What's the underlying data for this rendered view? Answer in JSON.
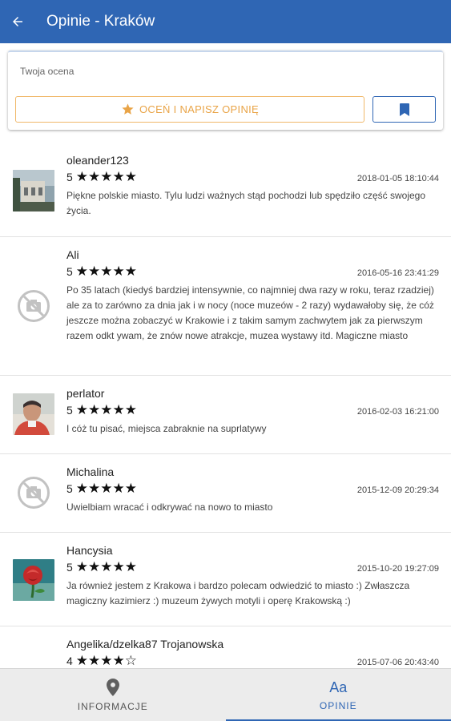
{
  "appbar": {
    "title": "Opinie - Kraków"
  },
  "rating_card": {
    "label": "Twoja ocena",
    "rate_button_label": "OCEŃ I NAPISZ OPINIĘ"
  },
  "reviews": [
    {
      "author": "oleander123",
      "rating": "5",
      "stars": "★★★★★",
      "date": "2018-01-05 18:10:44",
      "text": "Piękne polskie miasto. Tylu ludzi ważnych stąd pochodzi lub spędziło część swojego życia."
    },
    {
      "author": "Ali",
      "rating": "5",
      "stars": "★★★★★",
      "date": "2016-05-16 23:41:29",
      "text": "Po 35 latach (kiedyś bardziej intensywnie, co najmniej dwa razy w roku, teraz rzadziej) ale za to zarówno za dnia jak i w nocy (noce muzeów - 2 razy) wydawałoby się, że cóż jeszcze można zobaczyć w Krakowie i z takim samym zachwytem jak za pierwszym razem odkt ywam, że znów nowe atrakcje, muzea wystawy itd. Magiczne miasto"
    },
    {
      "author": "perlator",
      "rating": "5",
      "stars": "★★★★★",
      "date": "2016-02-03 16:21:00",
      "text": "I cóż tu pisać, miejsca zabraknie na suprlatywy"
    },
    {
      "author": "Michalina",
      "rating": "5",
      "stars": "★★★★★",
      "date": "2015-12-09 20:29:34",
      "text": "Uwielbiam wracać i odkrywać na nowo to miasto"
    },
    {
      "author": "Hancysia",
      "rating": "5",
      "stars": "★★★★★",
      "date": "2015-10-20 19:27:09",
      "text": "Ja również jestem z Krakowa i bardzo polecam odwiedzić to miasto :) Zwłaszcza magiczny kazimierz :) muzeum żywych motyli i operę Krakowską :)"
    },
    {
      "author": "Angelika/dzelka87 Trojanowska",
      "rating": "4",
      "stars": "★★★★☆",
      "date": "2015-07-06 20:43:40",
      "text": ""
    }
  ],
  "bottom_nav": {
    "info_label": "INFORMACJE",
    "opinions_icon": "Aa",
    "opinions_label": "OPINIE"
  },
  "colors": {
    "primary": "#2f66b4",
    "accent": "#e9a447"
  }
}
